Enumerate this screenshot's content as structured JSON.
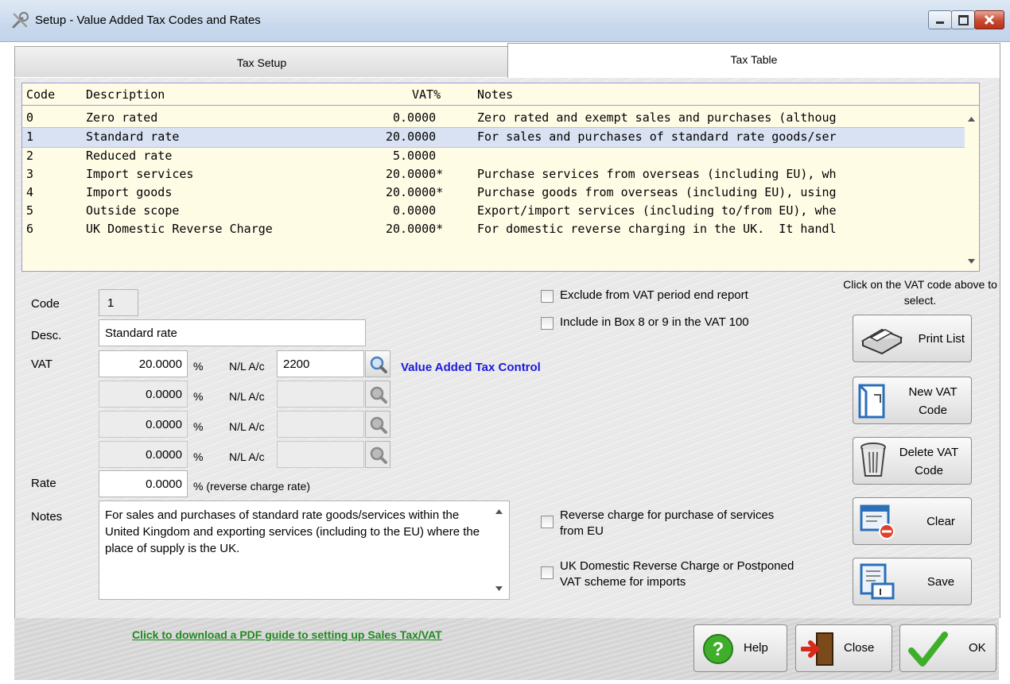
{
  "window": {
    "title": "Setup  -  Value Added Tax Codes and Rates"
  },
  "tabs": [
    {
      "label": "Tax Setup",
      "active": false
    },
    {
      "label": "Tax Table",
      "active": true
    }
  ],
  "list": {
    "headers": {
      "code": "Code",
      "description": "Description",
      "vat": "VAT%",
      "notes": "Notes"
    },
    "rows": [
      {
        "code": "0",
        "description": "Zero rated",
        "vat": "0.0000 ",
        "notes": "Zero rated and exempt sales and purchases (althoug"
      },
      {
        "code": "1",
        "description": "Standard rate",
        "vat": "20.0000 ",
        "notes": "For sales and purchases of standard rate goods/ser"
      },
      {
        "code": "2",
        "description": "Reduced rate",
        "vat": "5.0000 ",
        "notes": ""
      },
      {
        "code": "3",
        "description": "Import services",
        "vat": "20.0000*",
        "notes": "Purchase services from overseas (including EU), wh"
      },
      {
        "code": "4",
        "description": "Import goods",
        "vat": "20.0000*",
        "notes": "Purchase goods from overseas (including EU), using"
      },
      {
        "code": "5",
        "description": "Outside scope",
        "vat": "0.0000 ",
        "notes": "Export/import services (including to/from EU), whe"
      },
      {
        "code": "6",
        "description": "UK Domestic Reverse Charge",
        "vat": "20.0000*",
        "notes": "For domestic reverse charging in the UK.  It handl"
      }
    ],
    "selected_index": 1
  },
  "form": {
    "code_label": "Code",
    "code_value": "1",
    "desc_label": "Desc.",
    "desc_value": "Standard rate",
    "vat_label": "VAT",
    "vat_rows": [
      {
        "rate": "20.0000",
        "pct": "%",
        "nl_label": "N/L A/c",
        "account": "2200",
        "enabled": true
      },
      {
        "rate": "0.0000",
        "pct": "%",
        "nl_label": "N/L A/c",
        "account": "",
        "enabled": false
      },
      {
        "rate": "0.0000",
        "pct": "%",
        "nl_label": "N/L A/c",
        "account": "",
        "enabled": false
      },
      {
        "rate": "0.0000",
        "pct": "%",
        "nl_label": "N/L A/c",
        "account": "",
        "enabled": false
      }
    ],
    "account_name": "Value Added Tax Control",
    "rate_label": "Rate",
    "rate_value": "0.0000",
    "rate_suffix": "% (reverse charge rate)",
    "notes_label": "Notes",
    "notes_value": "For sales and purchases of standard rate goods/services within the United Kingdom and exporting services (including to the EU) where the place of supply is the UK.",
    "check_exclude": "Exclude from VAT period end report",
    "check_box89": "Include in Box 8 or 9 in the VAT 100",
    "check_reverse_eu": "Reverse charge for purchase of services from EU",
    "check_domestic": "UK Domestic Reverse Charge or Postponed VAT scheme for imports"
  },
  "side": {
    "hint": "Click on the VAT code above to select.",
    "print_list": "Print List",
    "new_code_1": "New VAT",
    "new_code_2": "Code",
    "delete_code_1": "Delete VAT",
    "delete_code_2": "Code",
    "clear": "Clear",
    "save": "Save"
  },
  "footer": {
    "pdf_link": "Click to download a PDF guide to setting up Sales Tax/VAT",
    "help": "Help",
    "close": "Close",
    "ok": "OK"
  },
  "colors": {
    "link_blue": "#1a1adf",
    "link_green": "#1f8a1f",
    "selected_row": "#d9e2f3",
    "list_bg": "#fffce6"
  }
}
